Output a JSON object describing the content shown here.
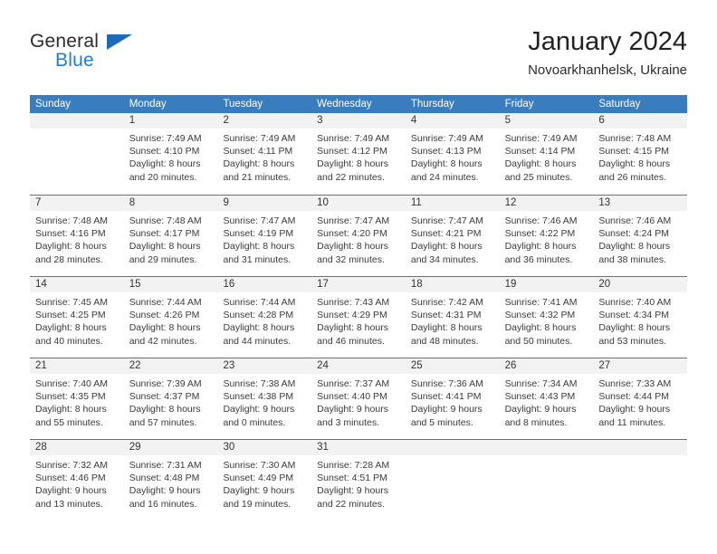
{
  "brand": {
    "word1": "General",
    "word2": "Blue",
    "flag_icon": "blue-triangle-flag-icon",
    "accent_color": "#1b7fd4"
  },
  "header": {
    "title": "January 2024",
    "subtitle": "Novoarkhanhelsk, Ukraine"
  },
  "theme": {
    "header_row_color": "#3a7dbf",
    "daynum_band_color": "#f2f2f2",
    "text_color": "#3a3a3a"
  },
  "calendar": {
    "weekdays": [
      "Sunday",
      "Monday",
      "Tuesday",
      "Wednesday",
      "Thursday",
      "Friday",
      "Saturday"
    ],
    "weeks": [
      [
        {
          "day": "",
          "lines": []
        },
        {
          "day": "1",
          "lines": [
            "Sunrise: 7:49 AM",
            "Sunset: 4:10 PM",
            "Daylight: 8 hours",
            "and 20 minutes."
          ]
        },
        {
          "day": "2",
          "lines": [
            "Sunrise: 7:49 AM",
            "Sunset: 4:11 PM",
            "Daylight: 8 hours",
            "and 21 minutes."
          ]
        },
        {
          "day": "3",
          "lines": [
            "Sunrise: 7:49 AM",
            "Sunset: 4:12 PM",
            "Daylight: 8 hours",
            "and 22 minutes."
          ]
        },
        {
          "day": "4",
          "lines": [
            "Sunrise: 7:49 AM",
            "Sunset: 4:13 PM",
            "Daylight: 8 hours",
            "and 24 minutes."
          ]
        },
        {
          "day": "5",
          "lines": [
            "Sunrise: 7:49 AM",
            "Sunset: 4:14 PM",
            "Daylight: 8 hours",
            "and 25 minutes."
          ]
        },
        {
          "day": "6",
          "lines": [
            "Sunrise: 7:48 AM",
            "Sunset: 4:15 PM",
            "Daylight: 8 hours",
            "and 26 minutes."
          ]
        }
      ],
      [
        {
          "day": "7",
          "lines": [
            "Sunrise: 7:48 AM",
            "Sunset: 4:16 PM",
            "Daylight: 8 hours",
            "and 28 minutes."
          ]
        },
        {
          "day": "8",
          "lines": [
            "Sunrise: 7:48 AM",
            "Sunset: 4:17 PM",
            "Daylight: 8 hours",
            "and 29 minutes."
          ]
        },
        {
          "day": "9",
          "lines": [
            "Sunrise: 7:47 AM",
            "Sunset: 4:19 PM",
            "Daylight: 8 hours",
            "and 31 minutes."
          ]
        },
        {
          "day": "10",
          "lines": [
            "Sunrise: 7:47 AM",
            "Sunset: 4:20 PM",
            "Daylight: 8 hours",
            "and 32 minutes."
          ]
        },
        {
          "day": "11",
          "lines": [
            "Sunrise: 7:47 AM",
            "Sunset: 4:21 PM",
            "Daylight: 8 hours",
            "and 34 minutes."
          ]
        },
        {
          "day": "12",
          "lines": [
            "Sunrise: 7:46 AM",
            "Sunset: 4:22 PM",
            "Daylight: 8 hours",
            "and 36 minutes."
          ]
        },
        {
          "day": "13",
          "lines": [
            "Sunrise: 7:46 AM",
            "Sunset: 4:24 PM",
            "Daylight: 8 hours",
            "and 38 minutes."
          ]
        }
      ],
      [
        {
          "day": "14",
          "lines": [
            "Sunrise: 7:45 AM",
            "Sunset: 4:25 PM",
            "Daylight: 8 hours",
            "and 40 minutes."
          ]
        },
        {
          "day": "15",
          "lines": [
            "Sunrise: 7:44 AM",
            "Sunset: 4:26 PM",
            "Daylight: 8 hours",
            "and 42 minutes."
          ]
        },
        {
          "day": "16",
          "lines": [
            "Sunrise: 7:44 AM",
            "Sunset: 4:28 PM",
            "Daylight: 8 hours",
            "and 44 minutes."
          ]
        },
        {
          "day": "17",
          "lines": [
            "Sunrise: 7:43 AM",
            "Sunset: 4:29 PM",
            "Daylight: 8 hours",
            "and 46 minutes."
          ]
        },
        {
          "day": "18",
          "lines": [
            "Sunrise: 7:42 AM",
            "Sunset: 4:31 PM",
            "Daylight: 8 hours",
            "and 48 minutes."
          ]
        },
        {
          "day": "19",
          "lines": [
            "Sunrise: 7:41 AM",
            "Sunset: 4:32 PM",
            "Daylight: 8 hours",
            "and 50 minutes."
          ]
        },
        {
          "day": "20",
          "lines": [
            "Sunrise: 7:40 AM",
            "Sunset: 4:34 PM",
            "Daylight: 8 hours",
            "and 53 minutes."
          ]
        }
      ],
      [
        {
          "day": "21",
          "lines": [
            "Sunrise: 7:40 AM",
            "Sunset: 4:35 PM",
            "Daylight: 8 hours",
            "and 55 minutes."
          ]
        },
        {
          "day": "22",
          "lines": [
            "Sunrise: 7:39 AM",
            "Sunset: 4:37 PM",
            "Daylight: 8 hours",
            "and 57 minutes."
          ]
        },
        {
          "day": "23",
          "lines": [
            "Sunrise: 7:38 AM",
            "Sunset: 4:38 PM",
            "Daylight: 9 hours",
            "and 0 minutes."
          ]
        },
        {
          "day": "24",
          "lines": [
            "Sunrise: 7:37 AM",
            "Sunset: 4:40 PM",
            "Daylight: 9 hours",
            "and 3 minutes."
          ]
        },
        {
          "day": "25",
          "lines": [
            "Sunrise: 7:36 AM",
            "Sunset: 4:41 PM",
            "Daylight: 9 hours",
            "and 5 minutes."
          ]
        },
        {
          "day": "26",
          "lines": [
            "Sunrise: 7:34 AM",
            "Sunset: 4:43 PM",
            "Daylight: 9 hours",
            "and 8 minutes."
          ]
        },
        {
          "day": "27",
          "lines": [
            "Sunrise: 7:33 AM",
            "Sunset: 4:44 PM",
            "Daylight: 9 hours",
            "and 11 minutes."
          ]
        }
      ],
      [
        {
          "day": "28",
          "lines": [
            "Sunrise: 7:32 AM",
            "Sunset: 4:46 PM",
            "Daylight: 9 hours",
            "and 13 minutes."
          ]
        },
        {
          "day": "29",
          "lines": [
            "Sunrise: 7:31 AM",
            "Sunset: 4:48 PM",
            "Daylight: 9 hours",
            "and 16 minutes."
          ]
        },
        {
          "day": "30",
          "lines": [
            "Sunrise: 7:30 AM",
            "Sunset: 4:49 PM",
            "Daylight: 9 hours",
            "and 19 minutes."
          ]
        },
        {
          "day": "31",
          "lines": [
            "Sunrise: 7:28 AM",
            "Sunset: 4:51 PM",
            "Daylight: 9 hours",
            "and 22 minutes."
          ]
        },
        {
          "day": "",
          "lines": []
        },
        {
          "day": "",
          "lines": []
        },
        {
          "day": "",
          "lines": []
        }
      ]
    ]
  }
}
